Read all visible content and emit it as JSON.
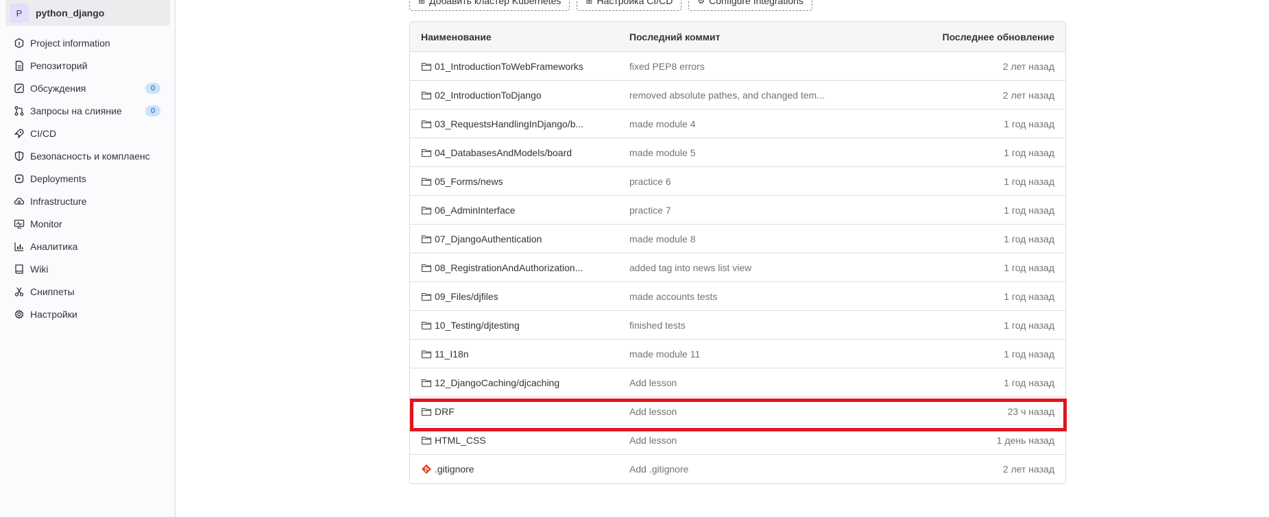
{
  "project": {
    "avatar_letter": "P",
    "name": "python_django"
  },
  "sidebar": {
    "items": [
      {
        "label": "Project information",
        "icon": "project-info-icon"
      },
      {
        "label": "Репозиторий",
        "icon": "repository-icon"
      },
      {
        "label": "Обсуждения",
        "icon": "issues-icon",
        "badge": "0"
      },
      {
        "label": "Запросы на слияние",
        "icon": "merge-request-icon",
        "badge": "0"
      },
      {
        "label": "CI/CD",
        "icon": "rocket-icon"
      },
      {
        "label": "Безопасность и комплаенс",
        "icon": "shield-icon"
      },
      {
        "label": "Deployments",
        "icon": "deployments-icon"
      },
      {
        "label": "Infrastructure",
        "icon": "cloud-gear-icon"
      },
      {
        "label": "Monitor",
        "icon": "monitor-icon"
      },
      {
        "label": "Аналитика",
        "icon": "chart-icon"
      },
      {
        "label": "Wiki",
        "icon": "book-icon"
      },
      {
        "label": "Сниппеты",
        "icon": "scissors-icon"
      },
      {
        "label": "Настройки",
        "icon": "gear-icon"
      }
    ]
  },
  "top_actions": [
    {
      "label": "Добавить кластер Kubernetes"
    },
    {
      "label": "Настройка CI/CD"
    },
    {
      "label": "Configure Integrations"
    }
  ],
  "table": {
    "headers": {
      "name": "Наименование",
      "commit": "Последний коммит",
      "updated": "Последнее обновление"
    },
    "rows": [
      {
        "name": "01_IntroductionToWebFrameworks",
        "commit": "fixed PEP8 errors",
        "updated": "2 лет назад",
        "type": "folder"
      },
      {
        "name": "02_IntroductionToDjango",
        "commit": "removed absolute pathes, and changed tem...",
        "updated": "2 лет назад",
        "type": "folder"
      },
      {
        "name": "03_RequestsHandlingInDjango/b...",
        "commit": "made module 4",
        "updated": "1 год назад",
        "type": "folder"
      },
      {
        "name": "04_DatabasesAndModels/board",
        "commit": "made module 5",
        "updated": "1 год назад",
        "type": "folder"
      },
      {
        "name": "05_Forms/news",
        "commit": "practice 6",
        "updated": "1 год назад",
        "type": "folder"
      },
      {
        "name": "06_AdminInterface",
        "commit": "practice 7",
        "updated": "1 год назад",
        "type": "folder"
      },
      {
        "name": "07_DjangoAuthentication",
        "commit": "made module 8",
        "updated": "1 год назад",
        "type": "folder"
      },
      {
        "name": "08_RegistrationAndAuthorization...",
        "commit": "added tag into news list view",
        "updated": "1 год назад",
        "type": "folder"
      },
      {
        "name": "09_Files/djfiles",
        "commit": "made accounts tests",
        "updated": "1 год назад",
        "type": "folder"
      },
      {
        "name": "10_Testing/djtesting",
        "commit": "finished tests",
        "updated": "1 год назад",
        "type": "folder"
      },
      {
        "name": "11_I18n",
        "commit": "made module 11",
        "updated": "1 год назад",
        "type": "folder"
      },
      {
        "name": "12_DjangoCaching/djcaching",
        "commit": "Add lesson",
        "updated": "1 год назад",
        "type": "folder"
      },
      {
        "name": "DRF",
        "commit": "Add lesson",
        "updated": "23 ч назад",
        "type": "folder"
      },
      {
        "name": "HTML_CSS",
        "commit": "Add lesson",
        "updated": "1 день назад",
        "type": "folder"
      },
      {
        "name": ".gitignore",
        "commit": "Add .gitignore",
        "updated": "2 лет назад",
        "type": "git-file"
      }
    ]
  },
  "colors": {
    "highlight": "#e0151f",
    "badge_bg": "#cbe2f9",
    "git_icon": "#e24329"
  }
}
